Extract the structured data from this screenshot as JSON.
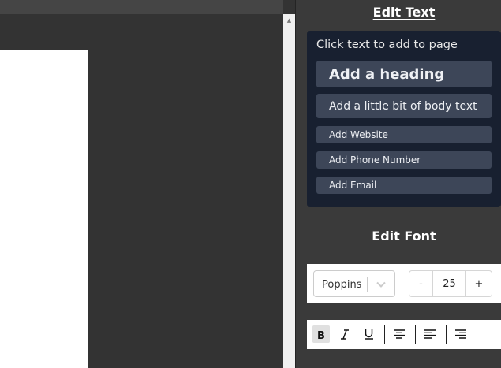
{
  "edit_text": {
    "title": "Edit Text",
    "hint": "Click text to add to page",
    "buttons": {
      "heading": "Add a heading",
      "body": "Add a little bit of body text",
      "website": "Add Website",
      "phone": "Add Phone Number",
      "email": "Add Email"
    }
  },
  "edit_font": {
    "title": "Edit Font",
    "font_family": "Poppins",
    "font_size": "25",
    "decrement_label": "-",
    "increment_label": "+"
  },
  "format_toolbar": {
    "bold_icon": "bold-icon",
    "italic_icon": "italic-icon",
    "underline_icon": "underline-icon",
    "align_center_icon": "align-center-icon",
    "align_left_icon": "align-left-icon",
    "align_right_icon": "align-right-icon",
    "active": "bold"
  },
  "colors": {
    "panel_bg": "#3a3a3a",
    "card_bg": "#182030",
    "button_bg": "#3d4658",
    "page_white": "#ffffff"
  }
}
